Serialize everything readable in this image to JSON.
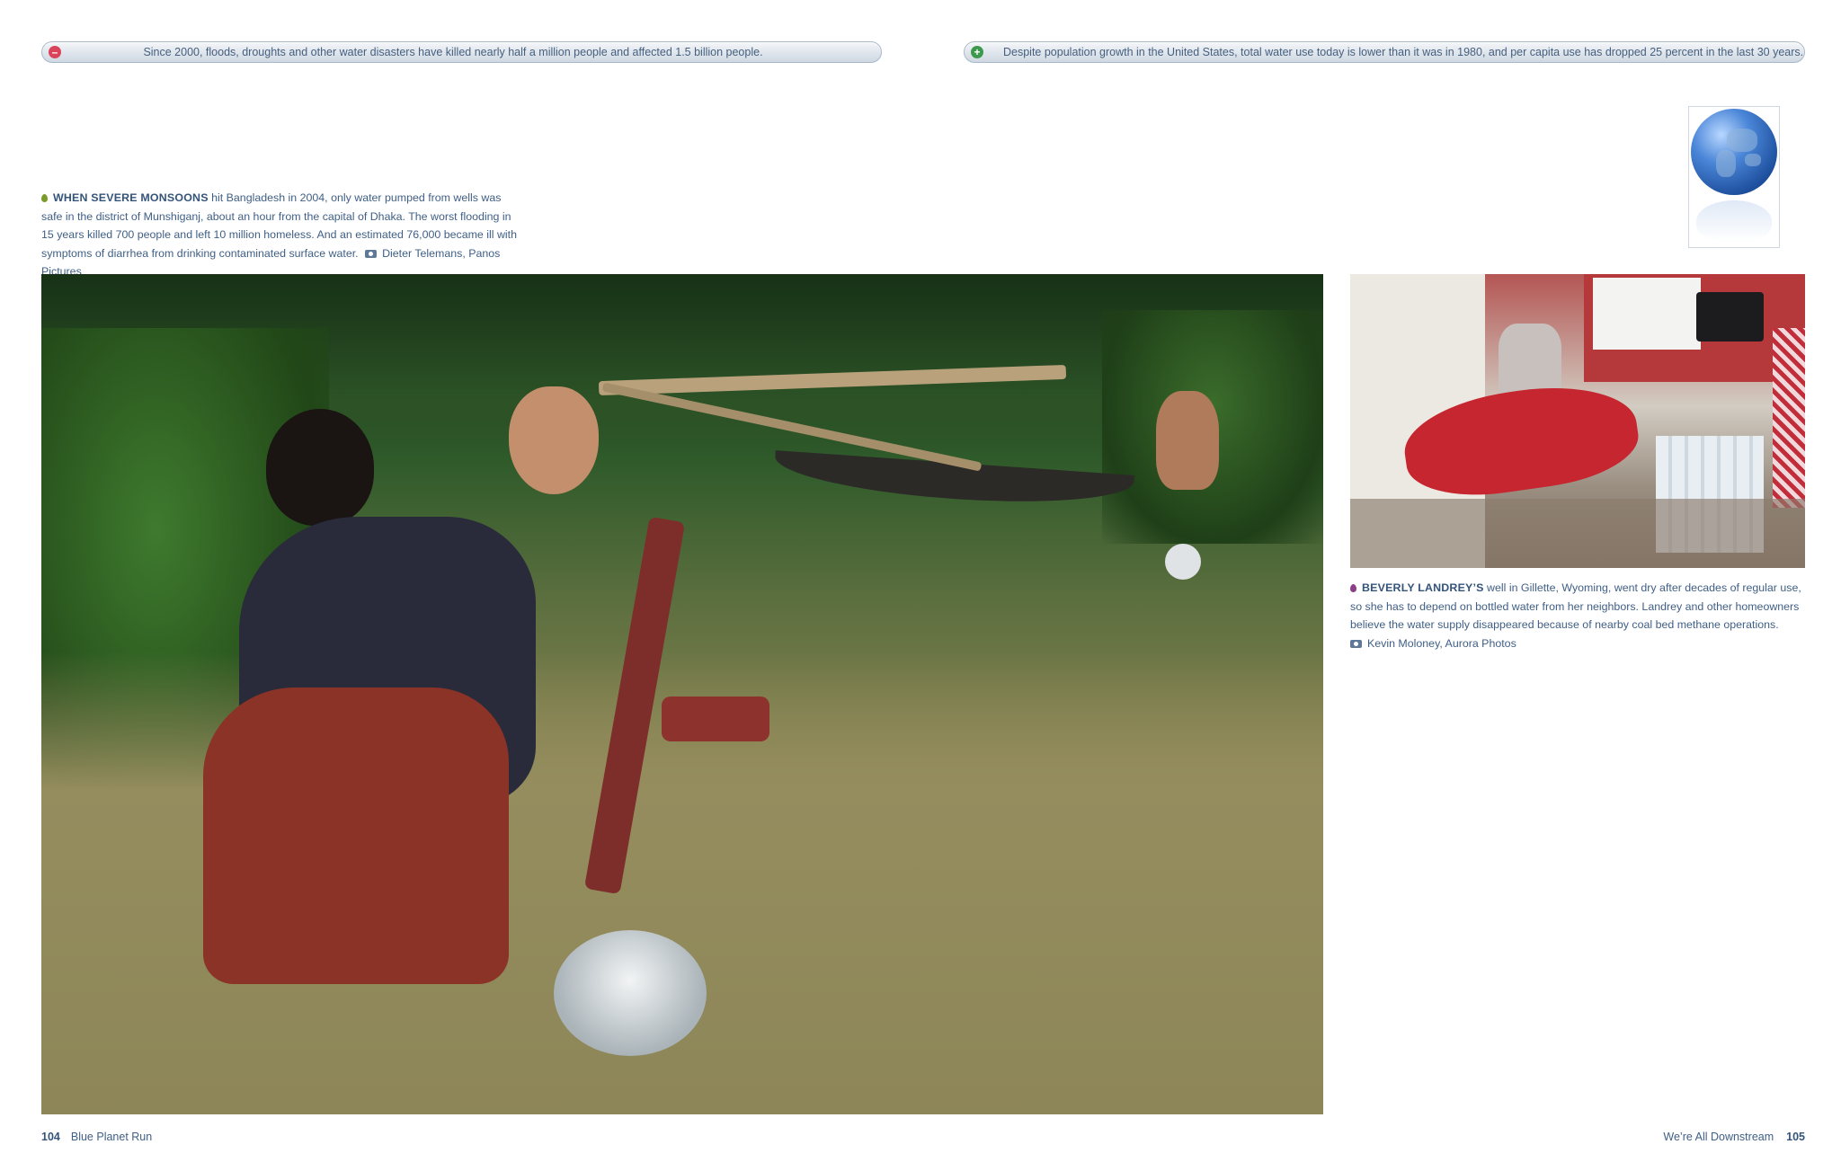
{
  "fact_bars": {
    "left": "Since 2000, floods, droughts and other water disasters have killed nearly half a million people and affected 1.5 billion people.",
    "right": "Despite population growth in the United States, total water use today is lower than it was in 1980, and per capita use has dropped 25 percent in the last 30 years."
  },
  "caption_left": {
    "lead": "When severe monsoons",
    "body": " hit Bangladesh in 2004, only water pumped from wells was safe in the district of Munshiganj, about an hour from the capital of Dhaka. The worst flooding in 15 years killed 700 people and left 10 million homeless. And an estimated 76,000 became ill with symptoms of diarrhea from drinking contaminated surface water.",
    "credit": "Dieter Telemans, Panos Pictures"
  },
  "caption_right": {
    "lead": "Beverly Landrey’s",
    "body": " well in Gillette, Wyoming, went dry after decades of regular use, so she has to depend on bottled water from her neighbors. Landrey and other homeowners believe the water supply disappeared because of nearby coal bed methane operations.",
    "credit": "Kevin Moloney, Aurora Photos"
  },
  "folio": {
    "left_number": "104",
    "left_title": "Blue Planet Run",
    "right_title": "We’re All Downstream",
    "right_number": "105"
  },
  "colors": {
    "text": "#3f5f86",
    "minus_badge": "#d9445a",
    "plus_badge": "#3d9a4c",
    "drop_green": "#7a9a2a",
    "drop_purple": "#8a3f86"
  },
  "icons": {
    "minus_badge": "minus-circle-icon",
    "plus_badge": "plus-circle-icon",
    "camera": "camera-icon",
    "globe": "globe-icon"
  }
}
